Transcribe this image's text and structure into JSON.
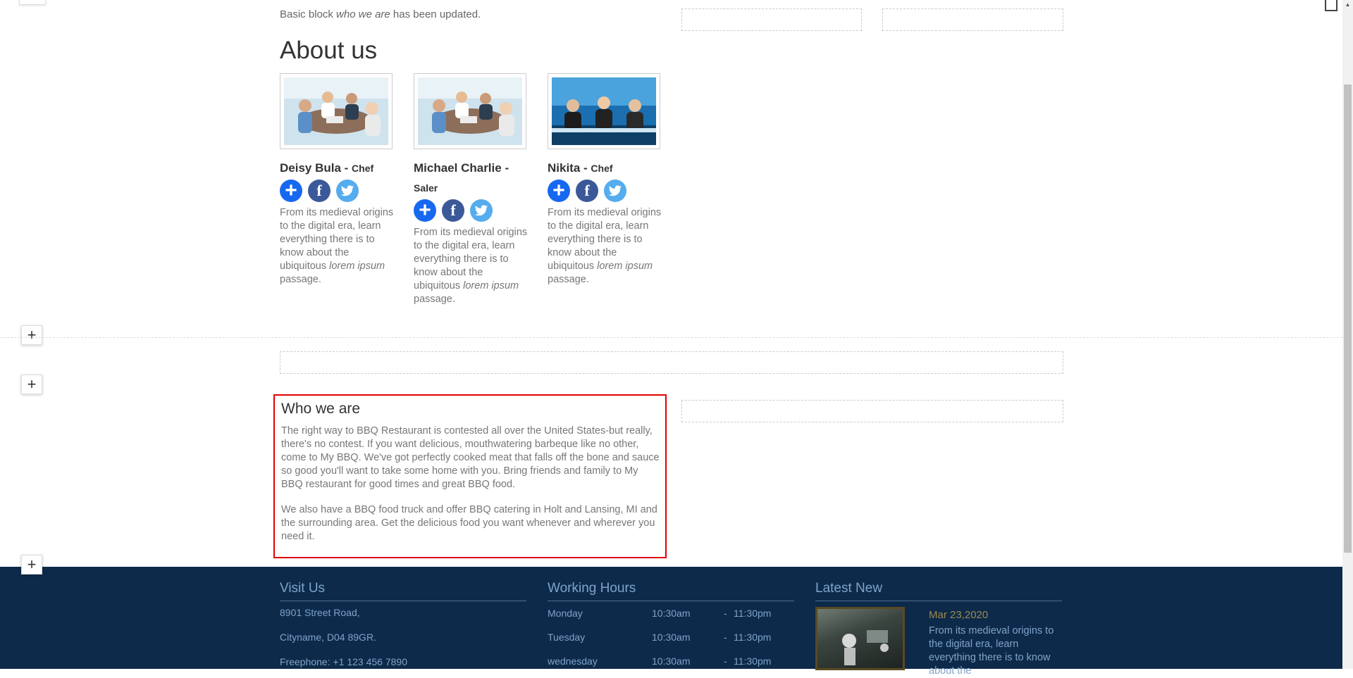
{
  "notice": {
    "prefix": "Basic block ",
    "emph": "who we are",
    "suffix": " has been updated."
  },
  "about": {
    "title": "About us",
    "members": [
      {
        "name": "Deisy Bula",
        "sep": " - ",
        "role": "Chef"
      },
      {
        "name": "Michael Charlie",
        "sep": " - ",
        "role": "Saler"
      },
      {
        "name": "Nikita",
        "sep": " - ",
        "role": "Chef"
      }
    ],
    "bio_start": "From its medieval origins to the digital era, learn everything there is to know about the ubiquitous ",
    "bio_emph": "lorem ipsum",
    "bio_end": " passage."
  },
  "social_icons": [
    "plus-icon",
    "facebook-icon",
    "twitter-icon"
  ],
  "add_button_label": "+",
  "who": {
    "title": "Who we are",
    "p1": "The right way to BBQ Restaurant is contested all over the United States-but really, there's no contest. If you want delicious, mouthwatering barbeque like no other, come to My BBQ. We've got perfectly cooked meat that falls off the bone and sauce so good you'll want to take some home with you. Bring friends and family to My BBQ restaurant for good times and great BBQ food.",
    "p2": "We also have a BBQ food truck and offer BBQ catering in Holt and Lansing, MI and the surrounding area. Get the delicious food you want whenever and wherever you need it."
  },
  "footer": {
    "visit": {
      "title": "Visit Us",
      "lines": [
        "8901 Street Road,",
        "Cityname, D04 89GR.",
        "Freephone: +1 123 456 7890"
      ]
    },
    "hours": {
      "title": "Working Hours",
      "rows": [
        {
          "day": "Monday",
          "open": "10:30am",
          "dash": "-",
          "close": "11:30pm"
        },
        {
          "day": "Tuesday",
          "open": "10:30am",
          "dash": "-",
          "close": "11:30pm"
        },
        {
          "day": "wednesday",
          "open": "10:30am",
          "dash": "-",
          "close": "11:30pm"
        }
      ]
    },
    "news": {
      "title": "Latest New",
      "date": "Mar 23,2020",
      "text": "From its medieval origins to the digital era, learn everything there is to know about the"
    }
  },
  "colors": {
    "highlight": "#e00000",
    "footer_bg": "#0d2a4a",
    "footer_text": "#7fa3c9",
    "plus": "#1768f0",
    "facebook": "#3b5998",
    "twitter": "#55acee"
  }
}
